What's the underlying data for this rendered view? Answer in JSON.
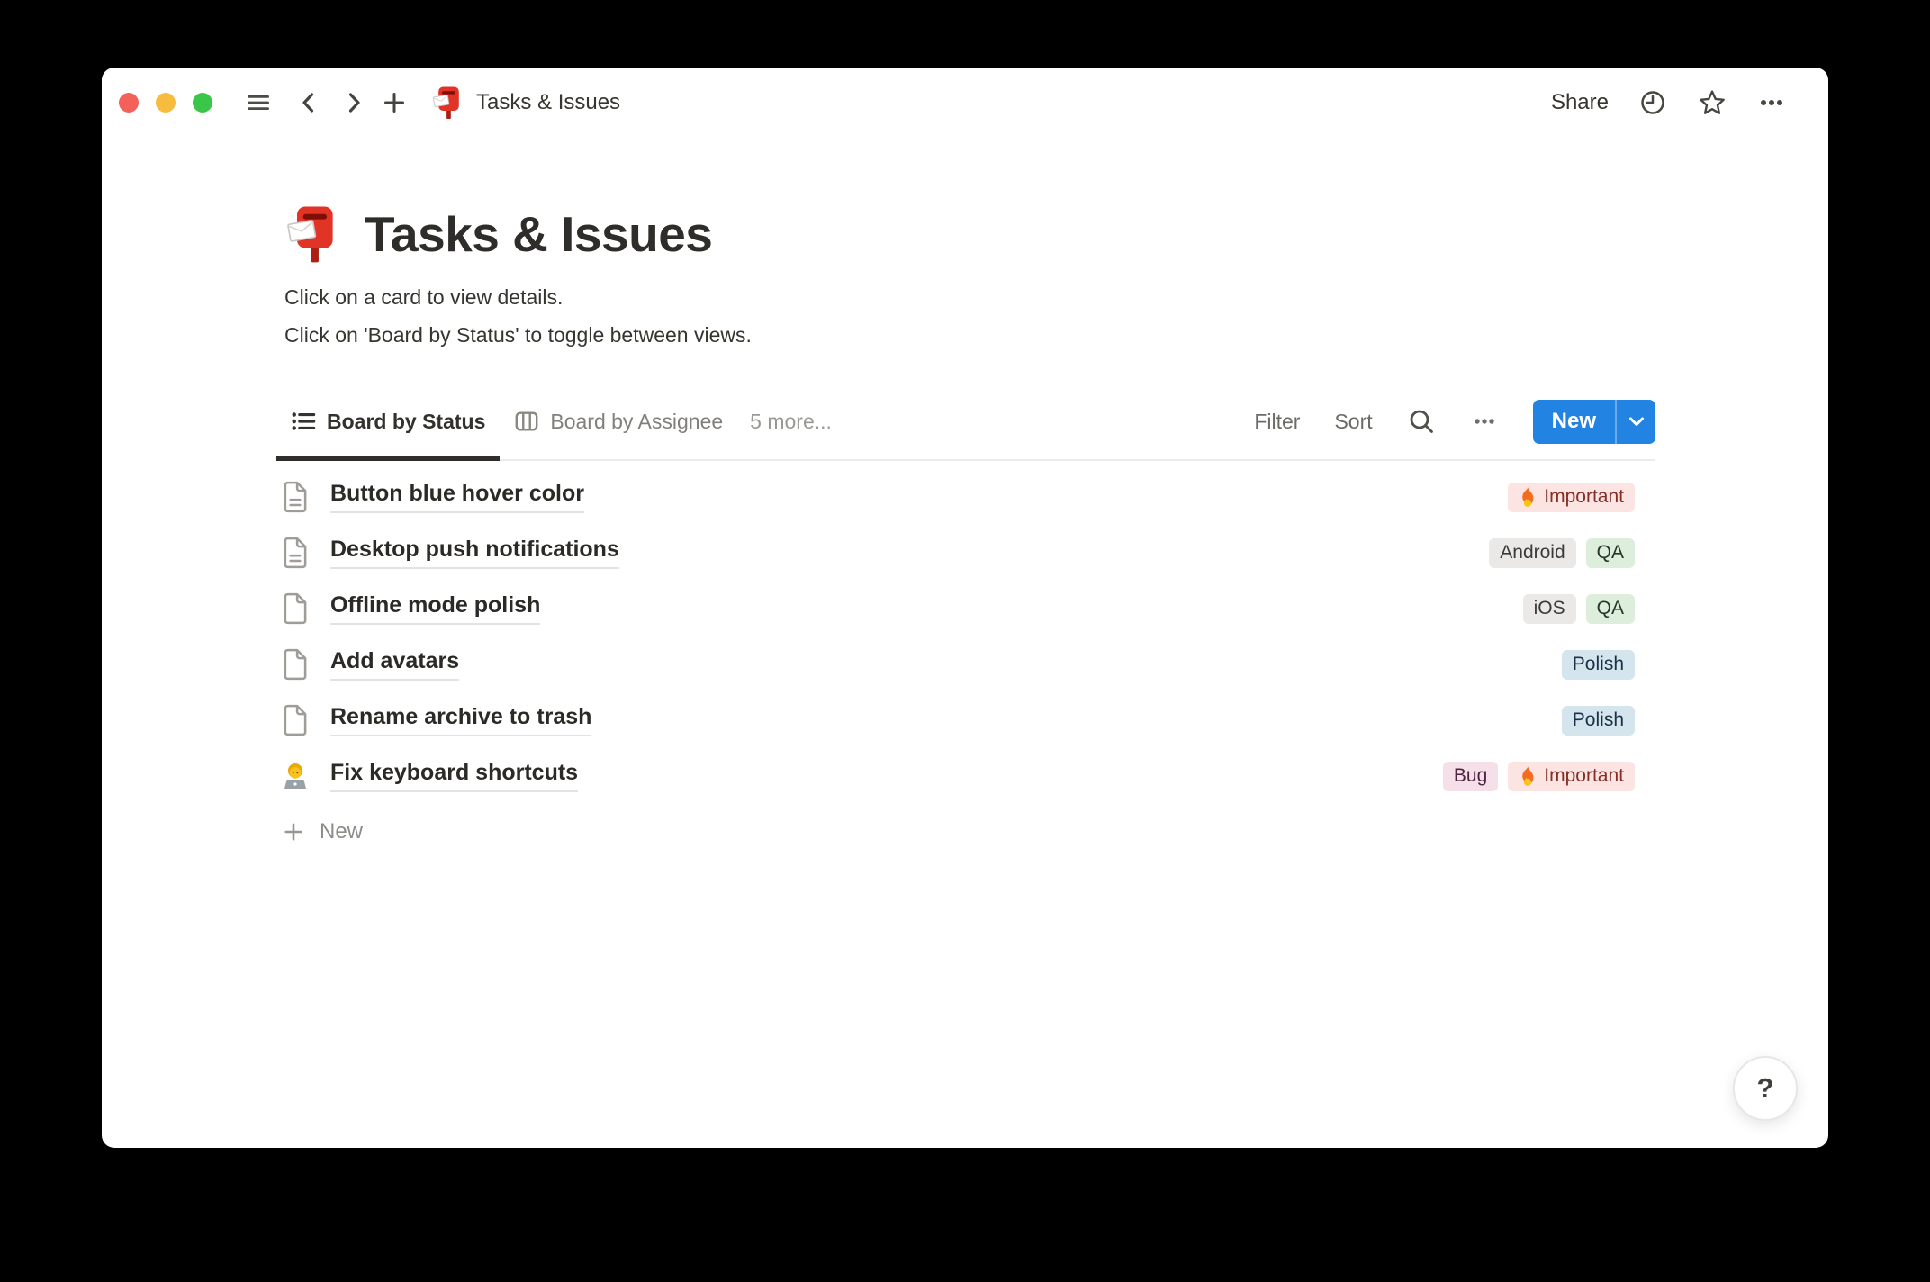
{
  "window": {
    "toolbar": {
      "title": "Tasks & Issues",
      "share_label": "Share",
      "icons": [
        "hamburger-icon",
        "chevron-left-icon",
        "chevron-right-icon",
        "plus-icon",
        "postbox-icon",
        "clock-icon",
        "star-icon",
        "ellipsis-icon"
      ]
    }
  },
  "page": {
    "emoji_icon": "postbox-icon",
    "title": "Tasks & Issues",
    "description_lines": [
      "Click on a card to view details.",
      "Click on 'Board by Status' to toggle between views."
    ],
    "views": {
      "tabs": [
        {
          "label": "Board by Status",
          "icon": "list-view-icon",
          "active": true
        },
        {
          "label": "Board by Assignee",
          "icon": "board-view-icon",
          "active": false
        }
      ],
      "more_label": "5 more...",
      "filter_label": "Filter",
      "sort_label": "Sort",
      "search_icon": "search-icon",
      "options_icon": "ellipsis-small-icon",
      "new_button_label": "New"
    },
    "rows": [
      {
        "icon": "page-text-icon",
        "title": "Button blue hover color",
        "tags": [
          {
            "label": "Important",
            "icon": "fire-icon",
            "color": "red"
          }
        ]
      },
      {
        "icon": "page-text-icon",
        "title": "Desktop push notifications",
        "tags": [
          {
            "label": "Android",
            "color": "gray"
          },
          {
            "label": "QA",
            "color": "green"
          }
        ]
      },
      {
        "icon": "page-icon",
        "title": "Offline mode polish",
        "tags": [
          {
            "label": "iOS",
            "color": "gray"
          },
          {
            "label": "QA",
            "color": "green"
          }
        ]
      },
      {
        "icon": "page-icon",
        "title": "Add avatars",
        "tags": [
          {
            "label": "Polish",
            "color": "blue"
          }
        ]
      },
      {
        "icon": "page-icon",
        "title": "Rename archive to trash",
        "tags": [
          {
            "label": "Polish",
            "color": "blue"
          }
        ]
      },
      {
        "icon": "technologist-icon",
        "title": "Fix keyboard shortcuts",
        "tags": [
          {
            "label": "Bug",
            "color": "pink"
          },
          {
            "label": "Important",
            "icon": "fire-icon",
            "color": "red"
          }
        ]
      }
    ],
    "add_row_label": "New",
    "help_label": "?"
  },
  "colors": {
    "accent_blue": "#2383e2",
    "tag_colors": {
      "red": {
        "bg": "#fbe4e1",
        "text": "#842e26"
      },
      "gray": {
        "bg": "#eae9e7",
        "text": "#3b3a36"
      },
      "green": {
        "bg": "#ddeedd",
        "text": "#23372a"
      },
      "blue": {
        "bg": "#d4e5ee",
        "text": "#1a3247"
      },
      "pink": {
        "bg": "#f5e0ea",
        "text": "#4f2340"
      }
    }
  }
}
